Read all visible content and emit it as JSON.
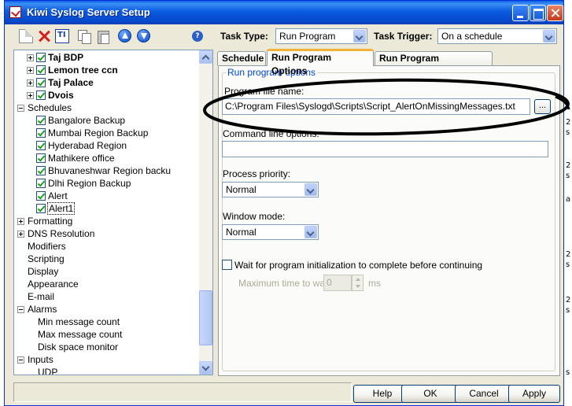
{
  "window": {
    "title": "Kiwi Syslog Server Setup"
  },
  "toolbar": {
    "task_type_label": "Task Type:",
    "task_type_value": "Run Program",
    "task_trigger_label": "Task Trigger:",
    "task_trigger_value": "On a schedule"
  },
  "tree": {
    "items": [
      {
        "label": "Taj BDP"
      },
      {
        "label": "Lemon tree ccn"
      },
      {
        "label": "Taj Palace"
      },
      {
        "label": "Dvois"
      },
      {
        "label": "Schedules"
      },
      {
        "label": "Bangalore Backup"
      },
      {
        "label": "Mumbai Region Backup"
      },
      {
        "label": "Hyderabad Region"
      },
      {
        "label": "Mathikere office"
      },
      {
        "label": "Bhuvaneshwar Region backu"
      },
      {
        "label": "Dlhi Region Backup"
      },
      {
        "label": "Alert"
      },
      {
        "label": "Alert1"
      },
      {
        "label": "Formatting"
      },
      {
        "label": "DNS Resolution"
      },
      {
        "label": "Modifiers"
      },
      {
        "label": "Scripting"
      },
      {
        "label": "Display"
      },
      {
        "label": "Appearance"
      },
      {
        "label": "E-mail"
      },
      {
        "label": "Alarms"
      },
      {
        "label": "Min message count"
      },
      {
        "label": "Max message count"
      },
      {
        "label": "Disk space monitor"
      },
      {
        "label": "Inputs"
      },
      {
        "label": "UDP"
      }
    ]
  },
  "tabs": [
    {
      "label": "Schedule"
    },
    {
      "label": "Run Program Options"
    },
    {
      "label": "Run Program Notification"
    }
  ],
  "run_program": {
    "group_label": "Run program options",
    "file_label": "Program file name:",
    "file_value": "C:\\Program Files\\Syslogd\\Scripts\\Script_AlertOnMissingMessages.txt",
    "browse_label": "...",
    "cmd_label": "Command line options:",
    "cmd_value": "",
    "priority_label": "Process priority:",
    "priority_value": "Normal",
    "window_mode_label": "Window mode:",
    "window_mode_value": "Normal",
    "wait_label": "Wait for program initialization to complete before continuing",
    "wait_checked": false,
    "max_wait_label": "Maximum time to wait:",
    "max_wait_value": "0",
    "max_wait_unit": "ms"
  },
  "buttons": {
    "help": "Help",
    "ok": "OK",
    "cancel": "Cancel",
    "apply": "Apply"
  },
  "background_fragments": [
    "2",
    "s",
    "2",
    "s",
    "a",
    "2",
    "s",
    "2",
    "s",
    "s"
  ],
  "colors": {
    "title_bar": "#0a5be0",
    "group_label": "#0046d5",
    "tab_highlight": "#f3b33a",
    "check_mark": "#21a121"
  }
}
